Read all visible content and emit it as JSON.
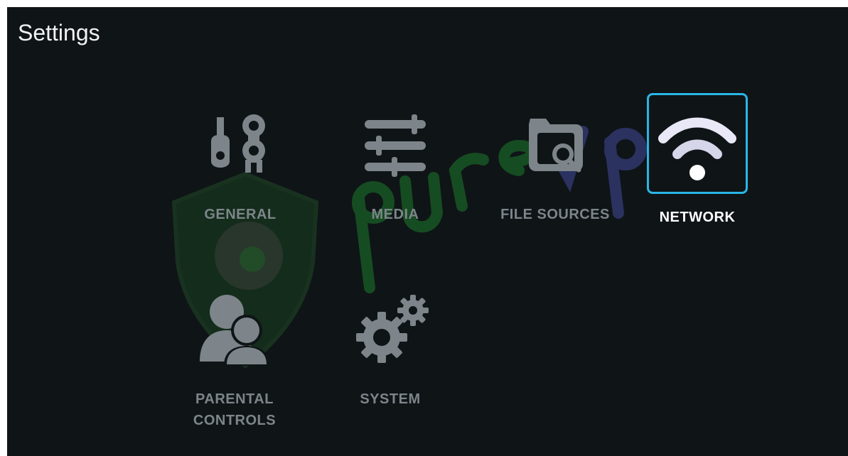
{
  "header": {
    "title": "Settings"
  },
  "watermark": {
    "brand": "purevpn",
    "color": "#1e6b2a",
    "accent": "#4b4f8a"
  },
  "tiles": [
    {
      "label": "GENERAL",
      "icon": "tools-icon",
      "selected": false
    },
    {
      "label": "MEDIA",
      "icon": "sliders-icon",
      "selected": false
    },
    {
      "label": "FILE SOURCES",
      "icon": "folder-search-icon",
      "selected": false
    },
    {
      "label": "NETWORK",
      "icon": "wifi-icon",
      "selected": true
    },
    {
      "label": "PARENTAL CONTROLS",
      "label_line1": "PARENTAL",
      "label_line2": "CONTROLS",
      "icon": "users-icon",
      "selected": false
    },
    {
      "label": "SYSTEM",
      "icon": "gears-icon",
      "selected": false
    }
  ],
  "colors": {
    "background": "#0f1417",
    "selection_border": "#2ab6e6",
    "inactive": "#7d858a",
    "active": "#ffffff"
  }
}
